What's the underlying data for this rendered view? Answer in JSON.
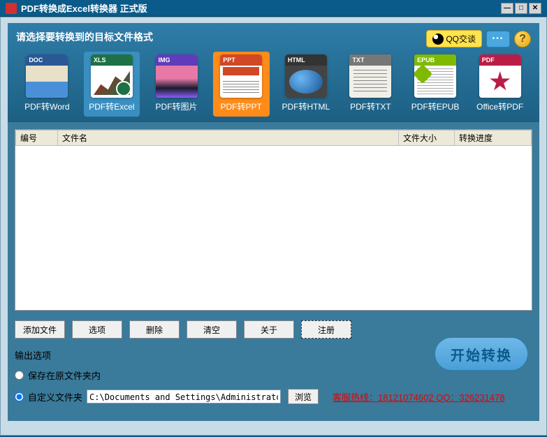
{
  "title": "PDF转换成Excel转换器  正式版",
  "prompt": "请选择要转换到的目标文件格式",
  "qq_label": "QQ交谈",
  "help_label": "?",
  "formats": [
    {
      "band": "DOC",
      "label": "PDF转Word"
    },
    {
      "band": "XLS",
      "label": "PDF转Excel"
    },
    {
      "band": "IMG",
      "label": "PDF转图片"
    },
    {
      "band": "PPT",
      "label": "PDF转PPT"
    },
    {
      "band": "HTML",
      "label": "PDF转HTML"
    },
    {
      "band": "TXT",
      "label": "PDF转TXT"
    },
    {
      "band": "EPUB",
      "label": "PDF转EPUB"
    },
    {
      "band": "PDF",
      "label": "Office转PDF"
    }
  ],
  "columns": {
    "num": "编号",
    "name": "文件名",
    "size": "文件大小",
    "progress": "转换进度"
  },
  "buttons": {
    "add": "添加文件",
    "options": "选项",
    "delete": "删除",
    "clear": "清空",
    "about": "关于",
    "register": "注册"
  },
  "output": {
    "title": "输出选项",
    "opt1": "保存在原文件夹内",
    "opt2": "自定义文件夹",
    "path": "C:\\Documents and Settings\\Administrator\\桌面",
    "browse": "浏览"
  },
  "convert": "开始转换",
  "hotline": "客服热线：18121074602 QQ：326231478"
}
